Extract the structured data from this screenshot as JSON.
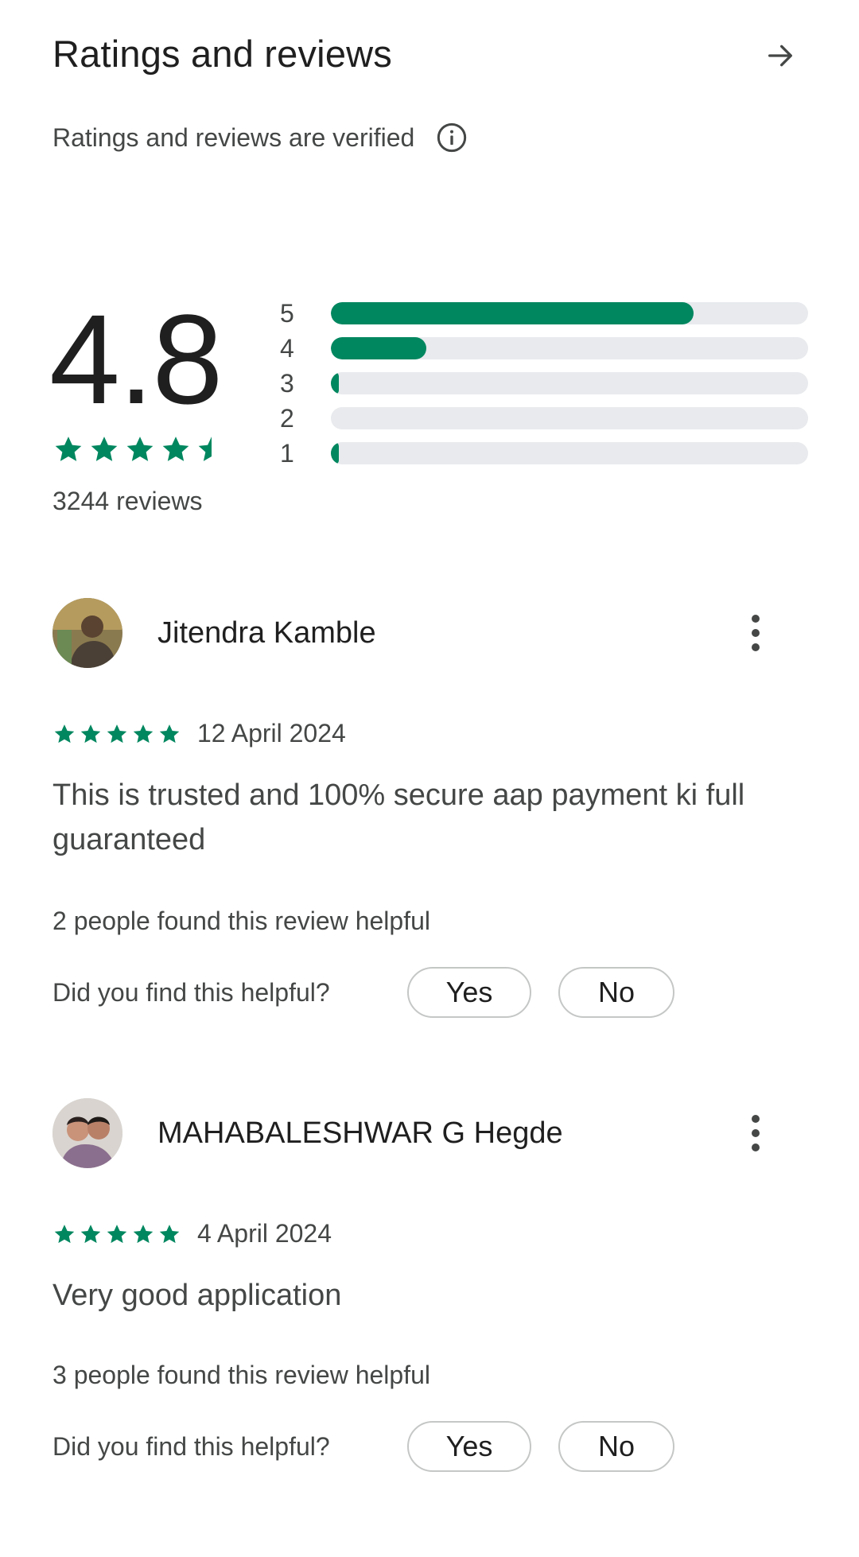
{
  "header": {
    "title": "Ratings and reviews",
    "verified_text": "Ratings and reviews are verified"
  },
  "summary": {
    "rating": "4.8",
    "stars": 4.5,
    "review_count_text": "3244 reviews",
    "distribution": [
      {
        "label": "5",
        "fraction": 0.76
      },
      {
        "label": "4",
        "fraction": 0.2
      },
      {
        "label": "3",
        "fraction": 0.012
      },
      {
        "label": "2",
        "fraction": 0.0
      },
      {
        "label": "1",
        "fraction": 0.017
      }
    ]
  },
  "reviews": [
    {
      "name": "Jitendra Kamble",
      "stars": 5,
      "date": "12 April 2024",
      "text": "This is trusted and 100% secure aap payment ki full guaranteed",
      "helpful_count_text": "2 people found this review helpful",
      "helpful_question": "Did you find this helpful?",
      "yes_label": "Yes",
      "no_label": "No"
    },
    {
      "name": "MAHABALESHWAR G Hegde",
      "stars": 5,
      "date": "4 April 2024",
      "text": "Very good application",
      "helpful_count_text": "3 people found this review helpful",
      "helpful_question": "Did you find this helpful?",
      "yes_label": "Yes",
      "no_label": "No"
    }
  ],
  "colors": {
    "accent": "#01875f",
    "track": "#e8eaed",
    "text_primary": "#1f1f1f",
    "text_secondary": "#444746"
  },
  "icons": {
    "header_arrow": "arrow-right-icon",
    "info": "info-icon",
    "more": "more-vert-icon",
    "star": "star-icon"
  }
}
